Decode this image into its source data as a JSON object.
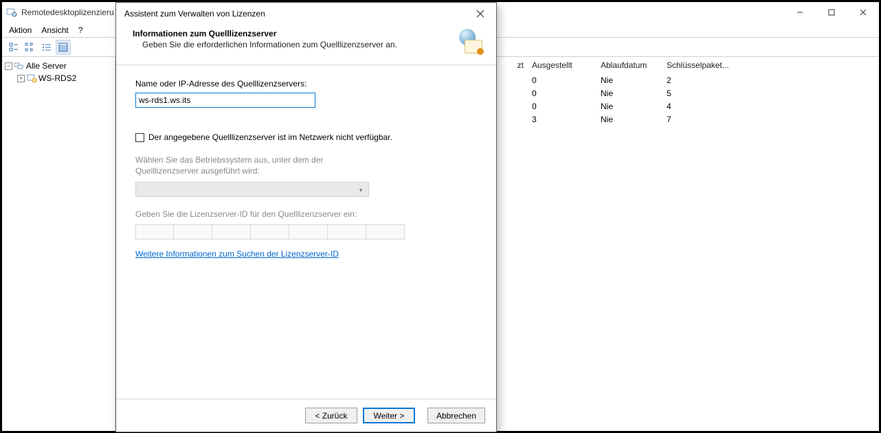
{
  "main": {
    "title": "Remotedesktoplizenzieru",
    "menu": {
      "action": "Aktion",
      "view": "Ansicht",
      "help": "?"
    },
    "tree": {
      "root": "Alle Server",
      "child": "WS-RDS2"
    },
    "columns": {
      "peek": "zt",
      "ausgestellt": "Ausgestellt",
      "ablauf": "Ablaufdatum",
      "schluessel": "Schlüsselpaket..."
    },
    "rows": [
      {
        "ausg": "0",
        "ablauf": "Nie",
        "schl": "2"
      },
      {
        "ausg": "0",
        "ablauf": "Nie",
        "schl": "5"
      },
      {
        "ausg": "0",
        "ablauf": "Nie",
        "schl": "4"
      },
      {
        "ausg": "3",
        "ablauf": "Nie",
        "schl": "7"
      }
    ]
  },
  "dialog": {
    "title": "Assistent zum Verwalten von Lizenzen",
    "heading": "Informationen zum Quelllizenzserver",
    "subheading": "Geben Sie die erforderlichen Informationen zum Quelllizenzserver an.",
    "name_label": "Name oder IP-Adresse des Quelllizenzservers:",
    "name_value": "ws-rds1.ws.its",
    "unavailable_label": "Der angegebene Quelllizenzserver ist im Netzwerk nicht verfügbar.",
    "os_label": "Wählen Sie das Betriebssystem aus, unter dem der Quelllizenzserver ausgeführt wird:",
    "id_label": "Geben Sie die Lizenzserver-ID für den Quelllizenzserver ein:",
    "link": "Weitere Informationen zum Suchen der Lizenzserver-ID",
    "buttons": {
      "back": "< Zurück",
      "next": "Weiter >",
      "cancel": "Abbrechen"
    }
  }
}
